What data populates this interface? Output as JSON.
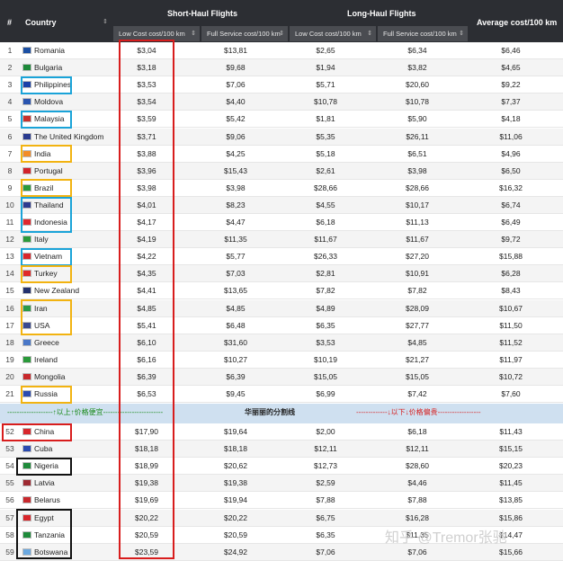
{
  "header": {
    "col_num": "#",
    "col_country": "Country",
    "group_short": "Short-Haul Flights",
    "group_long": "Long-Haul Flights",
    "col_avg": "Average cost/100 km",
    "sub_low1": "Low Cost cost/100 km",
    "sub_full1": "Full Service cost/100 km",
    "sub_low2": "Low Cost cost/100 km",
    "sub_full2": "Full Service cost/100 km",
    "sort_arrows": "⇕"
  },
  "rows_top": [
    {
      "n": "1",
      "country": "Romania",
      "flag": "#1b4fa3",
      "s_low": "$3,04",
      "s_full": "$13,81",
      "l_low": "$2,65",
      "l_full": "$6,34",
      "avg": "$6,46"
    },
    {
      "n": "2",
      "country": "Bulgaria",
      "flag": "#1e8a3a",
      "s_low": "$3,18",
      "s_full": "$9,68",
      "l_low": "$1,94",
      "l_full": "$3,82",
      "avg": "$4,65"
    },
    {
      "n": "3",
      "country": "Philippines",
      "flag": "#1940a8",
      "s_low": "$3,53",
      "s_full": "$7,06",
      "l_low": "$5,71",
      "l_full": "$20,60",
      "avg": "$9,22"
    },
    {
      "n": "4",
      "country": "Moldova",
      "flag": "#2a55b0",
      "s_low": "$3,54",
      "s_full": "$4,40",
      "l_low": "$10,78",
      "l_full": "$10,78",
      "avg": "$7,37"
    },
    {
      "n": "5",
      "country": "Malaysia",
      "flag": "#c9302c",
      "s_low": "$3,59",
      "s_full": "$5,42",
      "l_low": "$1,81",
      "l_full": "$5,90",
      "avg": "$4,18"
    },
    {
      "n": "6",
      "country": "The United Kingdom",
      "flag": "#2a3b8f",
      "s_low": "$3,71",
      "s_full": "$9,06",
      "l_low": "$5,35",
      "l_full": "$26,11",
      "avg": "$11,06"
    },
    {
      "n": "7",
      "country": "India",
      "flag": "#f28c28",
      "s_low": "$3,88",
      "s_full": "$4,25",
      "l_low": "$5,18",
      "l_full": "$6,51",
      "avg": "$4,96"
    },
    {
      "n": "8",
      "country": "Portugal",
      "flag": "#d2232a",
      "s_low": "$3,96",
      "s_full": "$15,43",
      "l_low": "$2,61",
      "l_full": "$3,98",
      "avg": "$6,50"
    },
    {
      "n": "9",
      "country": "Brazil",
      "flag": "#2a9a3a",
      "s_low": "$3,98",
      "s_full": "$3,98",
      "l_low": "$28,66",
      "l_full": "$28,66",
      "avg": "$16,32"
    },
    {
      "n": "10",
      "country": "Thailand",
      "flag": "#2d3b8f",
      "s_low": "$4,01",
      "s_full": "$8,23",
      "l_low": "$4,55",
      "l_full": "$10,17",
      "avg": "$6,74"
    },
    {
      "n": "11",
      "country": "Indonesia",
      "flag": "#e0282e",
      "s_low": "$4,17",
      "s_full": "$4,47",
      "l_low": "$6,18",
      "l_full": "$11,13",
      "avg": "$6,49"
    },
    {
      "n": "12",
      "country": "Italy",
      "flag": "#2a9a3a",
      "s_low": "$4,19",
      "s_full": "$11,35",
      "l_low": "$11,67",
      "l_full": "$11,67",
      "avg": "$9,72"
    },
    {
      "n": "13",
      "country": "Vietnam",
      "flag": "#d8262b",
      "s_low": "$4,22",
      "s_full": "$5,77",
      "l_low": "$26,33",
      "l_full": "$27,20",
      "avg": "$15,88"
    },
    {
      "n": "14",
      "country": "Turkey",
      "flag": "#e02a2a",
      "s_low": "$4,35",
      "s_full": "$7,03",
      "l_low": "$2,81",
      "l_full": "$10,91",
      "avg": "$6,28"
    },
    {
      "n": "15",
      "country": "New Zealand",
      "flag": "#23316e",
      "s_low": "$4,41",
      "s_full": "$13,65",
      "l_low": "$7,82",
      "l_full": "$7,82",
      "avg": "$8,43"
    },
    {
      "n": "16",
      "country": "Iran",
      "flag": "#2b9a47",
      "s_low": "$4,85",
      "s_full": "$4,85",
      "l_low": "$4,89",
      "l_full": "$28,09",
      "avg": "$10,67"
    },
    {
      "n": "17",
      "country": "USA",
      "flag": "#3a4a8f",
      "s_low": "$5,41",
      "s_full": "$6,48",
      "l_low": "$6,35",
      "l_full": "$27,77",
      "avg": "$11,50"
    },
    {
      "n": "18",
      "country": "Greece",
      "flag": "#4a78c8",
      "s_low": "$6,10",
      "s_full": "$31,60",
      "l_low": "$3,53",
      "l_full": "$4,85",
      "avg": "$11,52"
    },
    {
      "n": "19",
      "country": "Ireland",
      "flag": "#2a9a3a",
      "s_low": "$6,16",
      "s_full": "$10,27",
      "l_low": "$10,19",
      "l_full": "$21,27",
      "avg": "$11,97"
    },
    {
      "n": "20",
      "country": "Mongolia",
      "flag": "#c8282c",
      "s_low": "$6,39",
      "s_full": "$6,39",
      "l_low": "$15,05",
      "l_full": "$15,05",
      "avg": "$10,72"
    },
    {
      "n": "21",
      "country": "Russia",
      "flag": "#2a4ab0",
      "s_low": "$6,53",
      "s_full": "$9,45",
      "l_low": "$6,99",
      "l_full": "$7,42",
      "avg": "$7,60"
    }
  ],
  "separator": {
    "left": "-------------------↑以上↑价格便宜-------------------------",
    "center": "华丽丽的分割线",
    "right": "-------------↓以下↓价格偏贵------------------"
  },
  "rows_bottom": [
    {
      "n": "52",
      "country": "China",
      "flag": "#d8262b",
      "s_low": "$17,90",
      "s_full": "$19,64",
      "l_low": "$2,00",
      "l_full": "$6,18",
      "avg": "$11,43"
    },
    {
      "n": "53",
      "country": "Cuba",
      "flag": "#2a4ab0",
      "s_low": "$18,18",
      "s_full": "$18,18",
      "l_low": "$12,11",
      "l_full": "$12,11",
      "avg": "$15,15"
    },
    {
      "n": "54",
      "country": "Nigeria",
      "flag": "#1e8a3a",
      "s_low": "$18,99",
      "s_full": "$20,62",
      "l_low": "$12,73",
      "l_full": "$28,60",
      "avg": "$20,23"
    },
    {
      "n": "55",
      "country": "Latvia",
      "flag": "#9e2a32",
      "s_low": "$19,38",
      "s_full": "$19,38",
      "l_low": "$2,59",
      "l_full": "$4,46",
      "avg": "$11,45"
    },
    {
      "n": "56",
      "country": "Belarus",
      "flag": "#c8282c",
      "s_low": "$19,69",
      "s_full": "$19,94",
      "l_low": "$7,88",
      "l_full": "$7,88",
      "avg": "$13,85"
    },
    {
      "n": "57",
      "country": "Egypt",
      "flag": "#d8262b",
      "s_low": "$20,22",
      "s_full": "$20,22",
      "l_low": "$6,75",
      "l_full": "$16,28",
      "avg": "$15,86"
    },
    {
      "n": "58",
      "country": "Tanzania",
      "flag": "#1e8a3a",
      "s_low": "$20,59",
      "s_full": "$20,59",
      "l_low": "$6,35",
      "l_full": "$11,35",
      "avg": "$14,47"
    },
    {
      "n": "59",
      "country": "Botswana",
      "flag": "#6aa8e0",
      "s_low": "$23,59",
      "s_full": "$24,92",
      "l_low": "$7,06",
      "l_full": "$7,06",
      "avg": "$15,66"
    }
  ],
  "watermark": "知乎 @Tremor张驰",
  "colors": {
    "header_bg": "#2c2e33",
    "sub_bg": "#4a4c51",
    "separator_bg": "#cfe0f0",
    "blue": "#1aa3d8",
    "yellow": "#f2b311",
    "red": "#d81d1d",
    "black": "#111111"
  }
}
